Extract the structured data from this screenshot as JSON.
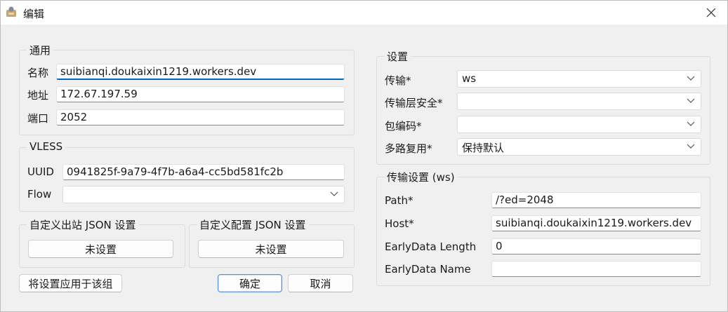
{
  "window": {
    "title": "编辑"
  },
  "general": {
    "title": "通用",
    "name_label": "名称",
    "name_value": "suibianqi.doukaixin1219.workers.dev",
    "address_label": "地址",
    "address_value": "172.67.197.59",
    "port_label": "端口",
    "port_value": "2052"
  },
  "vless": {
    "title": "VLESS",
    "uuid_label": "UUID",
    "uuid_value": "0941825f-9a79-4f7b-a6a4-cc5bd581fc2b",
    "flow_label": "Flow",
    "flow_value": ""
  },
  "outbound_json": {
    "title": "自定义出站 JSON 设置",
    "button": "未设置"
  },
  "config_json": {
    "title": "自定义配置 JSON 设置",
    "button": "未设置"
  },
  "apply_group_button": "将设置应用于该组",
  "ok_button": "确定",
  "cancel_button": "取消",
  "settings": {
    "title": "设置",
    "transport_label": "传输*",
    "transport_value": "ws",
    "tls_label": "传输层安全*",
    "tls_value": "",
    "packet_encoding_label": "包编码*",
    "packet_encoding_value": "",
    "mux_label": "多路复用*",
    "mux_value": "保持默认"
  },
  "transport": {
    "title": "传输设置 (ws)",
    "path_label": "Path*",
    "path_value": "/?ed=2048",
    "host_label": "Host*",
    "host_value": "suibianqi.doukaixin1219.workers.dev",
    "early_length_label": "EarlyData Length",
    "early_length_value": "0",
    "early_name_label": "EarlyData Name",
    "early_name_value": ""
  },
  "icons": {
    "app": "app-icon",
    "close": "close-icon",
    "dropdown": "chevron-down-icon"
  }
}
